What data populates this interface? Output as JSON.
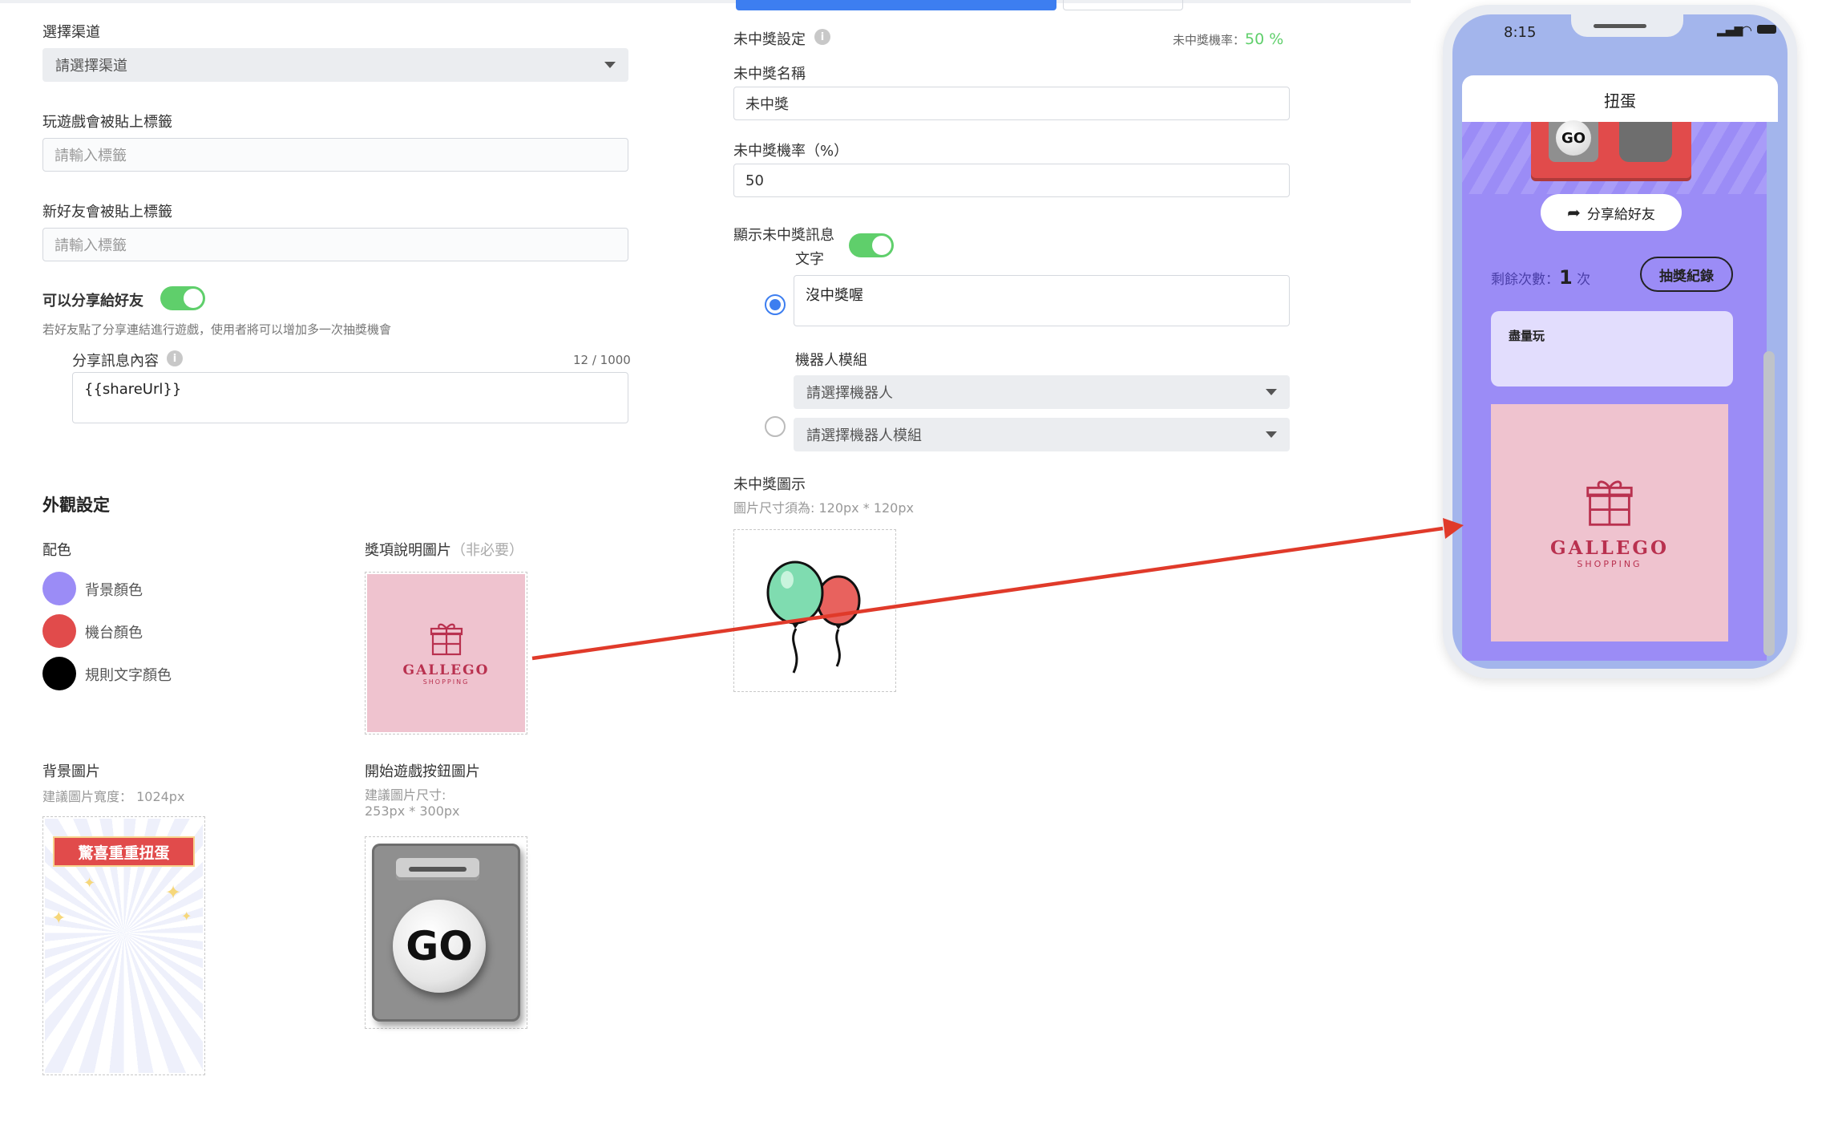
{
  "left": {
    "channel": {
      "label": "選擇渠道",
      "placeholder": "請選擇渠道"
    },
    "play_tag": {
      "label": "玩遊戲會被貼上標籤",
      "placeholder": "請輸入標籤"
    },
    "friend_tag": {
      "label": "新好友會被貼上標籤",
      "placeholder": "請輸入標籤"
    },
    "share": {
      "label": "可以分享給好友",
      "desc": "若好友點了分享連結進行遊戲，使用者將可以增加多一次抽獎機會",
      "message_label": "分享訊息內容",
      "counter": "12 / 1000",
      "message_value": "{{shareUrl}}"
    }
  },
  "appearance": {
    "title": "外觀設定",
    "palette_label": "配色",
    "colors": [
      {
        "label": "背景顏色",
        "hex": "#9b8cf6"
      },
      {
        "label": "機台顏色",
        "hex": "#e14b4b"
      },
      {
        "label": "規則文字顏色",
        "hex": "#000000"
      }
    ],
    "prize_image": {
      "label": "獎項說明圖片",
      "optional": "（非必要）"
    },
    "bg_image": {
      "label": "背景圖片",
      "hint": "建議圖片寬度： 1024px",
      "banner": "驚喜重重扭蛋"
    },
    "start_button": {
      "label": "開始遊戲按鈕圖片",
      "hint1": "建議圖片尺寸:",
      "hint2": "253px * 300px",
      "go": "GO"
    }
  },
  "logo": {
    "name": "GALLEGO",
    "sub": "SHOPPING"
  },
  "middle": {
    "no_prize_setting": "未中獎設定",
    "rate_label": "未中獎機率：",
    "rate_value": "50 %",
    "name_label": "未中獎名稱",
    "name_value": "未中獎",
    "rate_field_label": "未中獎機率（%）",
    "rate_field_value": "50",
    "show_msg_label": "顯示未中獎訊息",
    "text_option": "文字",
    "text_value": "沒中獎喔",
    "bot_option": "機器人模組",
    "bot_placeholder": "請選擇機器人",
    "bot_module_placeholder": "請選擇機器人模組",
    "icon_label": "未中獎圖示",
    "icon_hint": "圖片尺寸須為: 120px * 120px"
  },
  "phone": {
    "time": "8:15",
    "title": "扭蛋",
    "go": "GO",
    "share_btn": "分享給好友",
    "remaining_label": "剩餘次數：",
    "remaining_count": "1",
    "remaining_unit": "次",
    "history_btn": "抽獎紀錄",
    "rule_text": "盡量玩"
  },
  "accent": {
    "blue": "#3d7ef0",
    "green": "#5fcf6b",
    "arrow": "#e03a2a"
  }
}
